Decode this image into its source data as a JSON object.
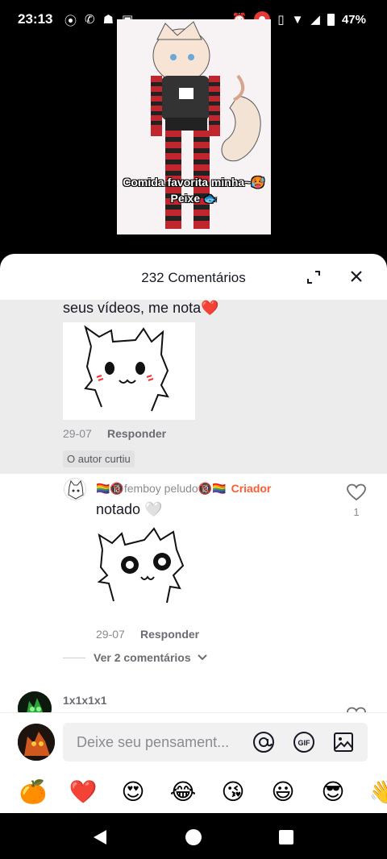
{
  "status_bar": {
    "time": "23:13",
    "battery": "47%",
    "left_icons": [
      "record-icon",
      "whatsapp-icon",
      "android-icon",
      "image-icon"
    ],
    "right_icons": [
      "alarm-icon",
      "screen-record-icon",
      "vibrate-icon",
      "wifi-icon",
      "signal-icon",
      "battery-icon"
    ]
  },
  "video": {
    "caption_line1": "Comida favorita minha~🥵",
    "caption_line2": "Peixe 🐟"
  },
  "comments_sheet": {
    "title": "232 Comentários",
    "highlighted_comment": {
      "text": "seus vídeos, me nota❤️",
      "date": "29-07",
      "reply_label": "Responder",
      "badge": "O autor curtiu"
    },
    "creator_reply": {
      "username": "🏳️‍🌈🔞femboy peludo🔞🏳️‍🌈",
      "creator_label": "Criador",
      "text": "notado 🤍",
      "date": "29-07",
      "reply_label": "Responder",
      "likes": "1"
    },
    "view_more": "Ver 2 comentários",
    "next_comment": {
      "username": "1x1x1x1"
    }
  },
  "input_bar": {
    "placeholder": "Deixe seu pensament..."
  },
  "emoji_row": [
    "🍊",
    "❤️",
    "😍",
    "😂",
    "😘",
    "😃",
    "😎",
    "👋"
  ],
  "colors": {
    "accent_creator": "#fe5c32",
    "highlight_bg": "#ececec"
  }
}
